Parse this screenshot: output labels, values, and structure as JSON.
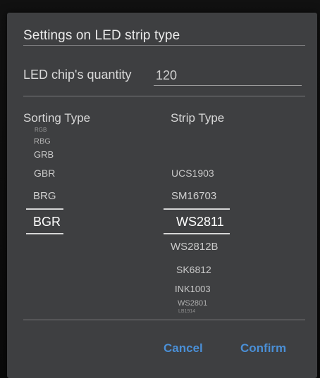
{
  "dialog": {
    "title": "Settings on LED strip type",
    "quantity_label": "LED chip's quantity",
    "quantity_value": "120"
  },
  "sorting": {
    "header": "Sorting Type",
    "items": [
      "RGB",
      "RBG",
      "GRB",
      "GBR",
      "BRG",
      "BGR"
    ],
    "selected": "BGR"
  },
  "strip": {
    "header": "Strip Type",
    "items": [
      "UCS1903",
      "SM16703",
      "WS2811",
      "WS2812B",
      "SK6812",
      "INK1003",
      "WS2801",
      "LB1914"
    ],
    "selected": "WS2811"
  },
  "actions": {
    "cancel": "Cancel",
    "confirm": "Confirm"
  },
  "colors": {
    "dialog_bg": "#3e3f41",
    "accent": "#4a8fd6"
  }
}
